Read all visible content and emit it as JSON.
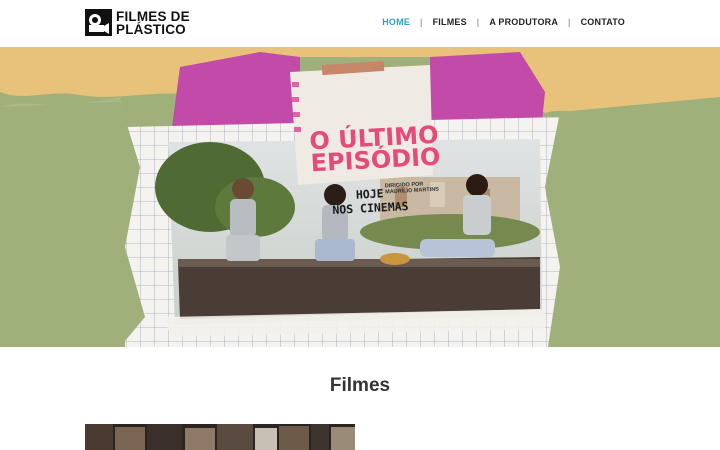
{
  "brand": {
    "line1": "FILMES DE",
    "line2": "PLÁSTICO",
    "logo_icon": "film-camera-icon"
  },
  "nav": {
    "items": [
      {
        "label": "HOME",
        "active": true
      },
      {
        "label": "FILMES",
        "active": false
      },
      {
        "label": "A PRODUTORA",
        "active": false
      },
      {
        "label": "CONTATO",
        "active": false
      }
    ],
    "separator": "|",
    "active_color": "#2e9fbf"
  },
  "hero": {
    "title_line1": "O ÚLTIMO",
    "title_line2": "EPISÓDIO",
    "directed_by_line1": "DIRIGIDO POR",
    "directed_by_line2": "MAURÍLIO MARTINS",
    "tagline_line1": "HOJE",
    "tagline_line2": "NOS CINEMAS",
    "colors": {
      "paper_tan": "#e8c27a",
      "magenta": "#c24aa8",
      "green": "#9fb07a",
      "title_pink": "#e64a78"
    }
  },
  "section": {
    "title": "Filmes"
  }
}
